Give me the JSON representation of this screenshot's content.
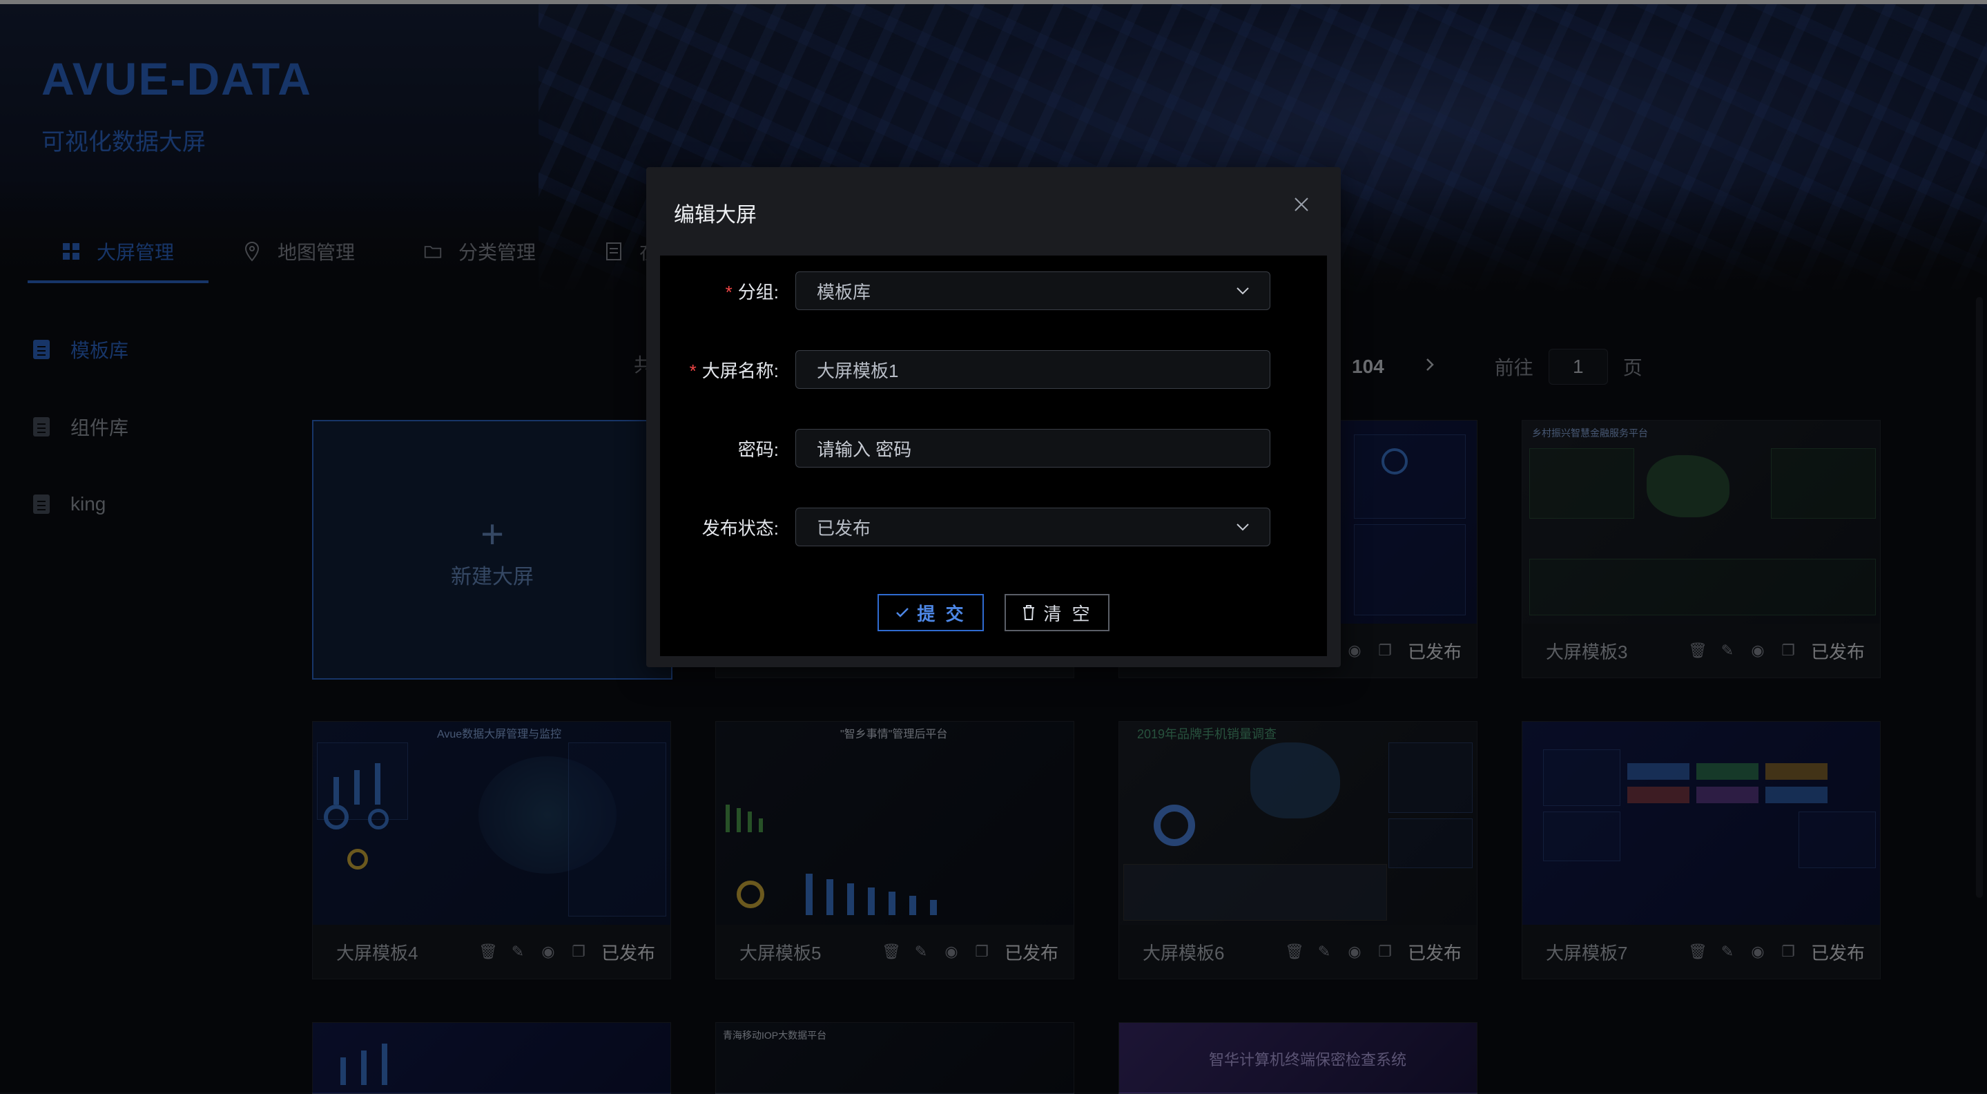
{
  "app": {
    "brand": "AVUE-DATA",
    "subtitle": "可视化数据大屏"
  },
  "nav": {
    "items": [
      {
        "label": "大屏管理",
        "icon": "grid-icon",
        "active": true
      },
      {
        "label": "地图管理",
        "icon": "location-pin-icon",
        "active": false
      },
      {
        "label": "分类管理",
        "icon": "folder-icon",
        "active": false
      },
      {
        "label": "在",
        "icon": "document-icon",
        "active": false
      }
    ]
  },
  "sidebar": {
    "items": [
      {
        "label": "模板库",
        "icon": "clipboard-icon",
        "active": true
      },
      {
        "label": "组件库",
        "icon": "clipboard-icon",
        "active": false
      },
      {
        "label": "king",
        "icon": "clipboard-icon",
        "active": false
      }
    ]
  },
  "pager": {
    "total_prefix": "共",
    "last_page": "104",
    "goto_prefix": "前往",
    "goto_value": "1",
    "goto_suffix": "页"
  },
  "new_card": {
    "plus": "+",
    "label": "新建大屏"
  },
  "cards": [
    {
      "name": "大屏模板3",
      "status": "已发布"
    },
    {
      "name": "",
      "status": "已发布"
    },
    {
      "name": "大屏模板4",
      "status": "已发布"
    },
    {
      "name": "大屏模板5",
      "status": "已发布"
    },
    {
      "name": "大屏模板6",
      "status": "已发布"
    },
    {
      "name": "大屏模板7",
      "status": "已发布"
    }
  ],
  "thumbs": {
    "card4_title": "Avue数据大屏管理与监控",
    "card5_title": "\"智乡事情\"管理后平台",
    "card6_title": "2019年品牌手机销量调查",
    "card3_title": "乡村振兴智慧金融服务平台",
    "bottom2_title": "青海移动IOP大数据平台",
    "bottom3_title": "智华计算机终端保密检查系统"
  },
  "dialog": {
    "title": "编辑大屏",
    "close": "×",
    "fields": {
      "group": {
        "label": "分组:",
        "value": "模板库",
        "required": true
      },
      "name": {
        "label": "大屏名称:",
        "value": "大屏模板1",
        "required": true
      },
      "password": {
        "label": "密码:",
        "placeholder": "请输入 密码",
        "required": false
      },
      "status": {
        "label": "发布状态:",
        "value": "已发布",
        "required": false
      }
    },
    "submit": "提 交",
    "clear": "清 空"
  },
  "colors": {
    "accent": "#2f6bd1",
    "background": "#0b0d12",
    "required": "#f04646"
  }
}
